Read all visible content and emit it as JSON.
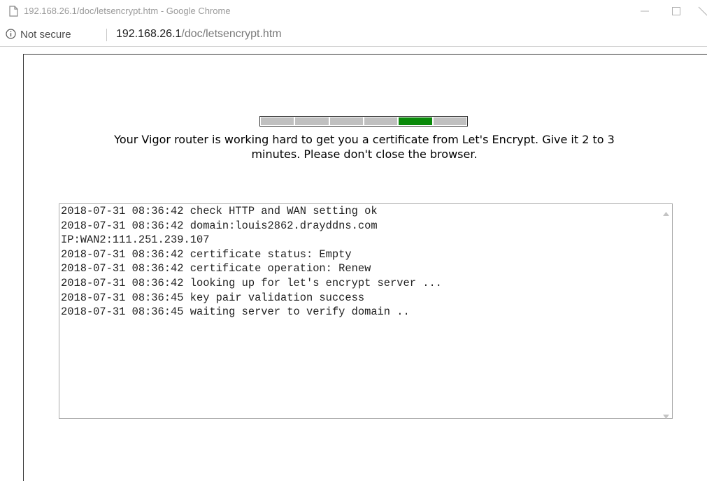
{
  "window": {
    "title": "192.168.26.1/doc/letsencrypt.htm - Google Chrome"
  },
  "address_bar": {
    "security_label": "Not secure",
    "url_host": "192.168.26.1",
    "url_path": "/doc/letsencrypt.htm"
  },
  "progress": {
    "segments": 6,
    "active_segment": 5,
    "active_color": "#0a8a0a",
    "inactive_color": "#c0c0c0"
  },
  "message": {
    "line1": "Your Vigor router is working hard to get you a certificate from Let's Encrypt. Give it 2 to 3",
    "line2": "minutes. Please don't close the browser."
  },
  "log": {
    "lines": [
      "2018-07-31 08:36:42 check HTTP and WAN setting ok",
      "2018-07-31 08:36:42 domain:louis2862.drayddns.com",
      "IP:WAN2:111.251.239.107",
      "2018-07-31 08:36:42 certificate status: Empty",
      "2018-07-31 08:36:42 certificate operation: Renew",
      "2018-07-31 08:36:42 looking up for let's encrypt server ...",
      "2018-07-31 08:36:45 key pair validation success",
      "2018-07-31 08:36:45 waiting server to verify domain .."
    ]
  },
  "icons": {
    "page": "page-icon",
    "info": "info-icon",
    "minimize": "minimize-icon",
    "maximize": "maximize-icon",
    "close": "close-icon"
  }
}
